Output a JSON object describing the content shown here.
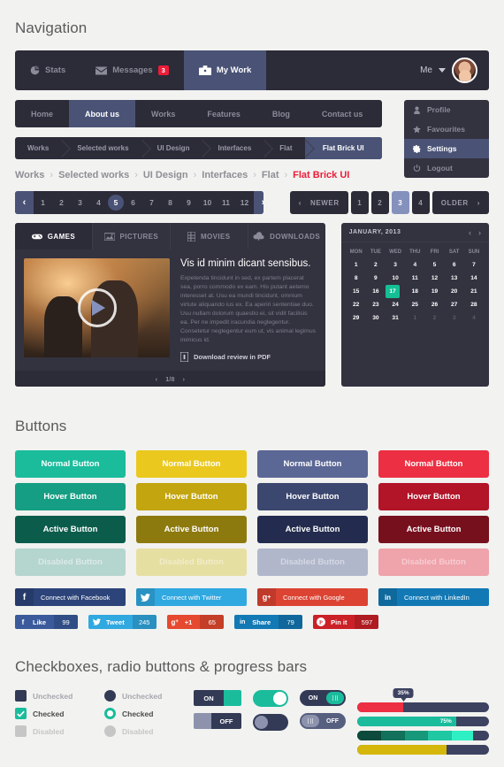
{
  "sections": {
    "navigation": "Navigation",
    "buttons": "Buttons",
    "controls": "Checkboxes, radio buttons & progress bars"
  },
  "toolbar": {
    "items": [
      {
        "label": "Stats",
        "icon": "pie-chart-icon",
        "active": false,
        "badge": ""
      },
      {
        "label": "Messages",
        "icon": "envelope-icon",
        "active": false,
        "badge": "3"
      },
      {
        "label": "My Work",
        "icon": "briefcase-icon",
        "active": true,
        "badge": ""
      }
    ],
    "user_label": "Me"
  },
  "dropdown": {
    "items": [
      {
        "label": "Profile",
        "icon": "user-icon",
        "active": false
      },
      {
        "label": "Favourites",
        "icon": "star-icon",
        "active": false
      },
      {
        "label": "Settings",
        "icon": "gear-icon",
        "active": true
      },
      {
        "label": "Logout",
        "icon": "power-icon",
        "active": false
      }
    ]
  },
  "mainnav": {
    "items": [
      {
        "label": "Home",
        "active": false
      },
      {
        "label": "About us",
        "active": true
      },
      {
        "label": "Works",
        "active": false
      },
      {
        "label": "Features",
        "active": false
      },
      {
        "label": "Blog",
        "active": false
      },
      {
        "label": "Contact us",
        "active": false
      }
    ]
  },
  "arrow_breadcrumb": {
    "items": [
      {
        "label": "Works",
        "active": false
      },
      {
        "label": "Selected works",
        "active": false
      },
      {
        "label": "UI Design",
        "active": false
      },
      {
        "label": "Interfaces",
        "active": false
      },
      {
        "label": "Flat",
        "active": false
      },
      {
        "label": "Flat Brick UI",
        "active": true
      }
    ]
  },
  "text_breadcrumb": {
    "separator": "›",
    "items": [
      "Works",
      "Selected works",
      "UI Design",
      "Interfaces",
      "Flat"
    ],
    "current": "Flat Brick UI"
  },
  "pagination": {
    "prev_icon": "chevron-left-icon",
    "next_icon": "chevron-right-icon",
    "pages": [
      "1",
      "2",
      "3",
      "4",
      "5",
      "6",
      "7",
      "8",
      "9",
      "10",
      "11",
      "12"
    ],
    "current": "5"
  },
  "pagination2": {
    "newer_label": "NEWER",
    "older_label": "OLDER",
    "pages": [
      "1",
      "2",
      "3",
      "4"
    ],
    "current": "3"
  },
  "media": {
    "tabs": [
      {
        "label": "GAMES",
        "icon": "gamepad-icon",
        "active": true
      },
      {
        "label": "PICTURES",
        "icon": "photo-icon",
        "active": false
      },
      {
        "label": "MOVIES",
        "icon": "film-icon",
        "active": false
      },
      {
        "label": "DOWNLOADS",
        "icon": "cloud-download-icon",
        "active": false
      }
    ],
    "title": "Vis id minim dicant sensibus.",
    "body": "Expetenda tincidunt in sed, ex partem placerat sea, porro commodo ex eam. His putant aetemo interesset at. Usu ea mundi tincidunt, omnium virtute aliquando ius ex. Ea aperiri sententiae duo. Usu nullam dolorum quaestio ei, sit vidit facilisis ea. Per ne impedit iracundia neglegentur. Consetetur neglegentur eum ut, vis animal legimus inimicus id.",
    "download_label": "Download review in PDF",
    "download_icon": "pdf-file-icon",
    "counter": "1/8",
    "prev_icon": "chevron-left-icon",
    "next_icon": "chevron-right-icon"
  },
  "calendar": {
    "month": "JANUARY, 2013",
    "prev_icon": "chevron-left-icon",
    "next_icon": "chevron-right-icon",
    "dow": [
      "MON",
      "TUE",
      "WED",
      "THU",
      "FRI",
      "SAT",
      "SUN"
    ],
    "weeks": [
      [
        {
          "d": "1"
        },
        {
          "d": "2"
        },
        {
          "d": "3"
        },
        {
          "d": "4"
        },
        {
          "d": "5"
        },
        {
          "d": "6"
        },
        {
          "d": "7"
        }
      ],
      [
        {
          "d": "8"
        },
        {
          "d": "9"
        },
        {
          "d": "10"
        },
        {
          "d": "11"
        },
        {
          "d": "12"
        },
        {
          "d": "13"
        },
        {
          "d": "14"
        }
      ],
      [
        {
          "d": "15"
        },
        {
          "d": "16"
        },
        {
          "d": "17",
          "sel": true
        },
        {
          "d": "18"
        },
        {
          "d": "19"
        },
        {
          "d": "20"
        },
        {
          "d": "21"
        }
      ],
      [
        {
          "d": "22"
        },
        {
          "d": "23"
        },
        {
          "d": "24"
        },
        {
          "d": "25"
        },
        {
          "d": "26"
        },
        {
          "d": "27"
        },
        {
          "d": "28"
        }
      ],
      [
        {
          "d": "29"
        },
        {
          "d": "30"
        },
        {
          "d": "31"
        },
        {
          "d": "1",
          "mut": true
        },
        {
          "d": "2",
          "mut": true
        },
        {
          "d": "3",
          "mut": true
        },
        {
          "d": "4",
          "mut": true
        }
      ]
    ],
    "selected_day": "17",
    "selected_color": "#15bf95"
  },
  "buttons": {
    "states": [
      "Normal Button",
      "Hover Button",
      "Active Button",
      "Disabled Button"
    ],
    "columns": [
      {
        "name": "green",
        "colors": [
          "#1abc9c",
          "#159e83",
          "#0c5c4c",
          "#b5d5cf"
        ]
      },
      {
        "name": "yellow",
        "colors": [
          "#eac81e",
          "#c2a50f",
          "#8d7a0e",
          "#e6dfa2"
        ]
      },
      {
        "name": "blue",
        "colors": [
          "#5b6795",
          "#3c476f",
          "#232c4e",
          "#b1b7cb"
        ]
      },
      {
        "name": "red",
        "colors": [
          "#ec2f42",
          "#b21428",
          "#76101d",
          "#efa3ab"
        ]
      }
    ]
  },
  "social": {
    "connect": [
      {
        "label": "Connect with Facebook",
        "icon": "facebook-icon",
        "glyph": "f",
        "color": "#2c4479"
      },
      {
        "label": "Connect with Twitter",
        "icon": "twitter-icon",
        "glyph": "ᵗ",
        "color": "#30a8e0"
      },
      {
        "label": "Connect with Google",
        "icon": "google-plus-icon",
        "glyph": "g+",
        "color": "#dc4332"
      },
      {
        "label": "Connect with LinkedIn",
        "icon": "linkedin-icon",
        "glyph": "in",
        "color": "#1279b5"
      }
    ],
    "share": [
      {
        "label": "Like",
        "count": "99",
        "icon": "facebook-icon",
        "glyph": "f",
        "color": "#3a5a9b"
      },
      {
        "label": "Tweet",
        "count": "245",
        "icon": "twitter-icon",
        "glyph": "t",
        "color": "#30a8e0"
      },
      {
        "label": "+1",
        "count": "65",
        "icon": "google-plus-icon",
        "glyph": "g+",
        "color": "#e5492f"
      },
      {
        "label": "Share",
        "count": "79",
        "icon": "linkedin-icon",
        "glyph": "in",
        "color": "#1279b5"
      },
      {
        "label": "Pin it",
        "count": "597",
        "icon": "pinterest-icon",
        "glyph": "P",
        "color": "#cb2027"
      }
    ]
  },
  "checkboxes": {
    "square": [
      {
        "label": "Unchecked",
        "state": "unchecked"
      },
      {
        "label": "Checked",
        "state": "checked"
      },
      {
        "label": "Disabled",
        "state": "disabled"
      }
    ],
    "radio": [
      {
        "label": "Unchecked",
        "state": "unchecked"
      },
      {
        "label": "Checked",
        "state": "checked"
      },
      {
        "label": "Disabled",
        "state": "disabled"
      }
    ]
  },
  "toggles": {
    "square": [
      {
        "label": "ON",
        "on": true
      },
      {
        "label": "OFF",
        "on": false
      }
    ],
    "round": [
      {
        "on": true
      },
      {
        "on": false
      }
    ],
    "round_labeled": [
      {
        "label": "ON",
        "on": true
      },
      {
        "label": "OFF",
        "on": false
      }
    ]
  },
  "progress": {
    "tooltip": "35%",
    "bars": [
      {
        "value": 35,
        "color": "#ec2f42",
        "label": ""
      },
      {
        "value": 75,
        "color": "#1abc9c",
        "label": "75%"
      },
      {
        "value": 88,
        "color": "#1abc9c",
        "label": "",
        "segmented": true
      },
      {
        "value": 68,
        "color": "#d4b70a",
        "label": ""
      }
    ],
    "track_color": "#3d4260",
    "segments": [
      "#0c4a3c",
      "#12715b",
      "#17987a",
      "#1fc8a2",
      "#2ef0c4"
    ]
  }
}
